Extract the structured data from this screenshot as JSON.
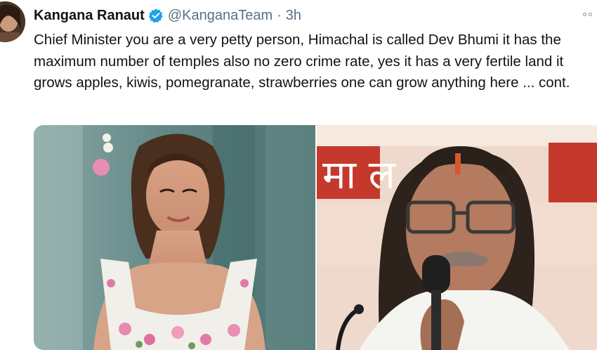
{
  "tweet": {
    "author": {
      "display_name": "Kangana Ranaut",
      "verified_icon": "verified-badge-icon",
      "handle": "@KanganaTeam",
      "separator": "·",
      "timestamp": "3h"
    },
    "more_icon": "more-options-icon",
    "text": "Chief Minister you are a very petty person, Himachal is called Dev Bhumi it has the maximum number of temples also no zero crime rate, yes it has a very fertile land it grows apples, kiwis, pomegranate, strawberries one can grow anything here ... cont.",
    "media": {
      "images": [
        "photo-left-woman",
        "photo-right-man-at-microphone"
      ],
      "background_letters": "मा      ल"
    }
  },
  "colors": {
    "verified": "#1da1f2",
    "secondary_text": "#5b7083",
    "primary_text": "#0f1419"
  }
}
